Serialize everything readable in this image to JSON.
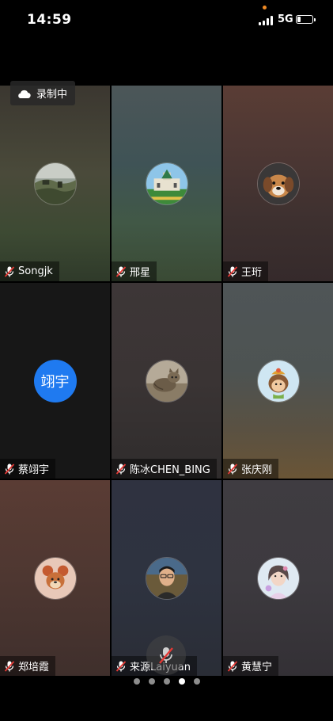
{
  "status_bar": {
    "time": "14:59",
    "network": "5G",
    "signal_icon": "cellular-signal-icon",
    "battery_icon": "battery-icon",
    "indicator_color": "#f08a24"
  },
  "recording": {
    "label": "录制中",
    "icon": "cloud-icon"
  },
  "participants": [
    {
      "name": "Songjk",
      "avatar": "landscape-photo",
      "muted": true
    },
    {
      "name": "邢星",
      "avatar": "building-photo",
      "muted": true
    },
    {
      "name": "王珩",
      "avatar": "dog-photo",
      "muted": true
    },
    {
      "name": "蔡翊宇",
      "avatar_text": "翊宇",
      "avatar_color": "#1f7af0",
      "muted": true
    },
    {
      "name": "陈冰CHEN_BING",
      "avatar": "cat-photo",
      "muted": true
    },
    {
      "name": "张庆刚",
      "avatar": "cartoon-character",
      "muted": true
    },
    {
      "name": "郑培霞",
      "avatar": "cartoon-mouse",
      "muted": true
    },
    {
      "name": "来源Laiyuan",
      "avatar": "person-photo",
      "muted": true
    },
    {
      "name": "黄慧宁",
      "avatar": "woman-photo",
      "muted": true
    }
  ],
  "floating_mic": {
    "icon": "microphone-muted-icon",
    "state": "muted"
  },
  "pagination": {
    "total": 5,
    "current": 4
  },
  "colors": {
    "accent_blue": "#1f7af0",
    "mute_red": "#e53935"
  }
}
